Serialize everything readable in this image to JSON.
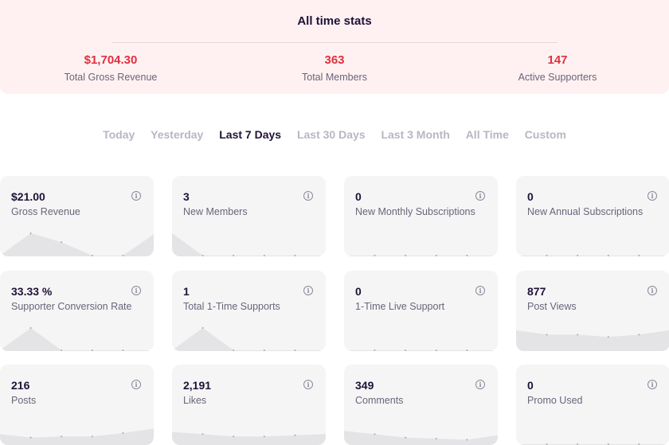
{
  "all_time": {
    "title": "All time stats",
    "stats": [
      {
        "value": "$1,704.30",
        "label": "Total Gross Revenue"
      },
      {
        "value": "363",
        "label": "Total Members"
      },
      {
        "value": "147",
        "label": "Active Supporters"
      }
    ]
  },
  "tabs": [
    {
      "label": "Today",
      "active": false
    },
    {
      "label": "Yesterday",
      "active": false
    },
    {
      "label": "Last 7 Days",
      "active": true
    },
    {
      "label": "Last 30 Days",
      "active": false
    },
    {
      "label": "Last 3 Month",
      "active": false
    },
    {
      "label": "All Time",
      "active": false
    },
    {
      "label": "Custom",
      "active": false
    }
  ],
  "cards": [
    {
      "value": "$21.00",
      "label": "Gross Revenue",
      "icon": "info-icon",
      "spark": [
        0,
        1,
        0.6,
        0,
        0,
        0.95
      ]
    },
    {
      "value": "3",
      "label": "New Members",
      "icon": "info-icon",
      "spark": [
        1,
        0,
        0,
        0,
        0,
        0
      ]
    },
    {
      "value": "0",
      "label": "New Monthly Subscriptions",
      "icon": "info-icon",
      "spark": [
        0,
        0,
        0,
        0,
        0,
        0
      ]
    },
    {
      "value": "0",
      "label": "New Annual Subscriptions",
      "icon": "info-icon",
      "spark": [
        0,
        0,
        0,
        0,
        0,
        0
      ]
    },
    {
      "value": "33.33 %",
      "label": "Supporter Conversion Rate",
      "icon": "info-icon",
      "spark": [
        0,
        1,
        0,
        0,
        0,
        0
      ]
    },
    {
      "value": "1",
      "label": "Total 1-Time Supports",
      "icon": "info-icon",
      "spark": [
        0,
        1,
        0,
        0,
        0,
        0
      ]
    },
    {
      "value": "0",
      "label": "1-Time Live Support",
      "icon": "info-icon",
      "spark": [
        0,
        0,
        0,
        0,
        0,
        0
      ]
    },
    {
      "value": "877",
      "label": "Post Views",
      "icon": "info-icon",
      "spark": [
        0.9,
        0.7,
        0.7,
        0.6,
        0.7,
        0.9
      ]
    },
    {
      "value": "216",
      "label": "Posts",
      "icon": "info-icon",
      "spark": [
        0.45,
        0.3,
        0.35,
        0.35,
        0.5,
        0.7
      ]
    },
    {
      "value": "2,191",
      "label": "Likes",
      "icon": "info-icon",
      "spark": [
        0.55,
        0.45,
        0.35,
        0.35,
        0.4,
        0.45
      ]
    },
    {
      "value": "349",
      "label": "Comments",
      "icon": "info-icon",
      "spark": [
        0.6,
        0.45,
        0.3,
        0.25,
        0.2,
        0.4
      ]
    },
    {
      "value": "0",
      "label": "Promo Used",
      "icon": "info-icon",
      "spark": [
        0,
        0,
        0,
        0,
        0,
        0
      ]
    }
  ],
  "colors": {
    "accent": "#e0303f",
    "header_bg": "#fff1f2",
    "card_bg": "#f5f5f6",
    "spark_fill": "#e4e4e6"
  }
}
